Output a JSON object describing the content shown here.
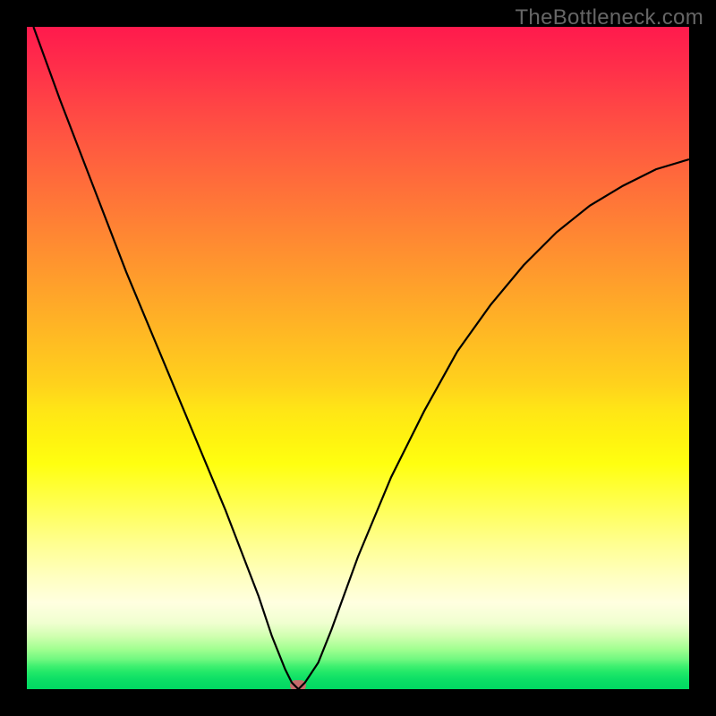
{
  "watermark": "TheBottleneck.com",
  "chart_data": {
    "type": "line",
    "title": "",
    "xlabel": "",
    "ylabel": "",
    "xlim": [
      0,
      100
    ],
    "ylim": [
      0,
      100
    ],
    "series": [
      {
        "name": "bottleneck-curve",
        "x": [
          1,
          5,
          10,
          15,
          20,
          25,
          30,
          35,
          37,
          39,
          40,
          41,
          42,
          44,
          46,
          50,
          55,
          60,
          65,
          70,
          75,
          80,
          85,
          90,
          95,
          100
        ],
        "values": [
          100,
          89,
          76,
          63,
          51,
          39,
          27,
          14,
          8,
          3,
          1,
          0,
          1,
          4,
          9,
          20,
          32,
          42,
          51,
          58,
          64,
          69,
          73,
          76,
          78.5,
          80
        ]
      }
    ],
    "marker": {
      "x": 41,
      "y": 0
    },
    "colors": {
      "gradient_top": "#ff1a4d",
      "gradient_mid": "#ffe616",
      "gradient_bottom": "#00d862",
      "curve": "#000000",
      "marker": "#c76b6b",
      "background": "#000000"
    }
  }
}
